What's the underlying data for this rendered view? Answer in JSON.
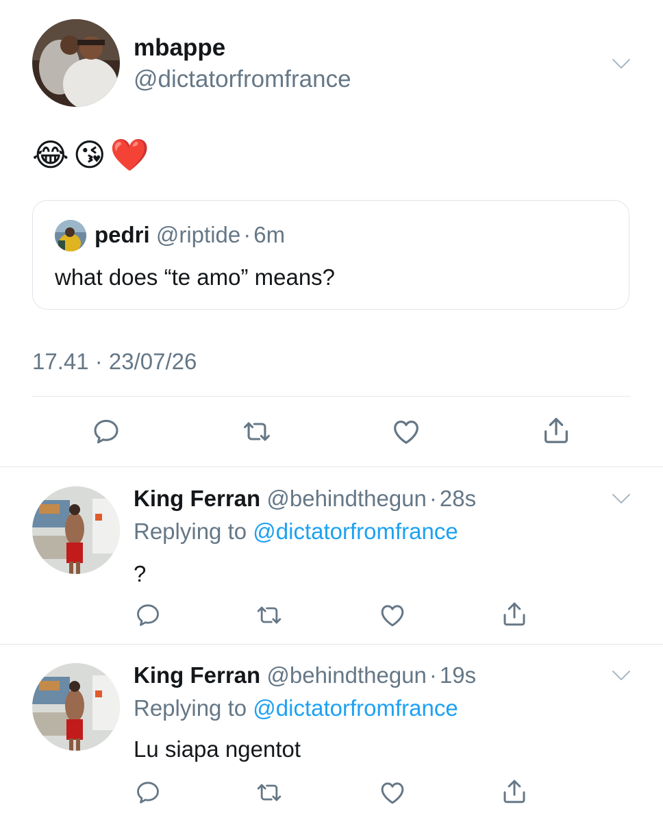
{
  "main_tweet": {
    "display_name": "mbappe",
    "handle": "@dictatorfromfrance",
    "body": "😂😘❤️",
    "timestamp": "17.41 · 23/07/26",
    "quoted": {
      "display_name": "pedri",
      "handle": "@riptide",
      "separator": "·",
      "time": "6m",
      "text": "what does “te amo” means?"
    }
  },
  "replies": [
    {
      "display_name": "King Ferran",
      "handle": "@behindthegun",
      "separator": "·",
      "time": "28s",
      "replying_prefix": "Replying to ",
      "replying_handle": "@dictatorfromfrance",
      "text": "?"
    },
    {
      "display_name": "King Ferran",
      "handle": "@behindthegun",
      "separator": "·",
      "time": "19s",
      "replying_prefix": "Replying to ",
      "replying_handle": "@dictatorfromfrance",
      "text": "Lu siapa ngentot"
    }
  ],
  "icons": {
    "chevron": "chevron-down-icon",
    "reply": "reply-icon",
    "retweet": "retweet-icon",
    "like": "heart-icon",
    "share": "share-icon"
  },
  "colors": {
    "text": "#14171a",
    "secondary": "#657786",
    "link": "#1da1f2",
    "divider": "#e1e8ed"
  }
}
